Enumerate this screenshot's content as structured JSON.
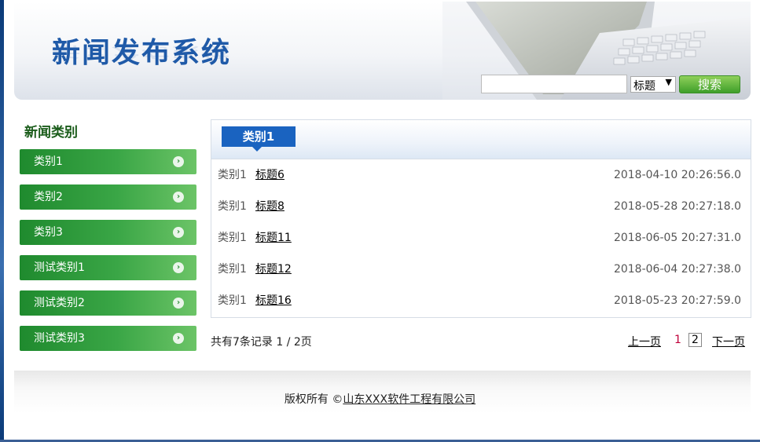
{
  "header": {
    "title": "新闻发布系统",
    "search": {
      "placeholder": "",
      "field_value": "",
      "select_value": "标题",
      "button_label": "搜索"
    }
  },
  "sidebar": {
    "title": "新闻类别",
    "items": [
      {
        "label": "类别1"
      },
      {
        "label": "类别2"
      },
      {
        "label": "类别3"
      },
      {
        "label": "测试类别1"
      },
      {
        "label": "测试类别2"
      },
      {
        "label": "测试类别3"
      }
    ]
  },
  "main": {
    "tab_label": "类别1",
    "news": [
      {
        "category": "类别1",
        "title": "标题6",
        "time": "2018-04-10 20:26:56.0"
      },
      {
        "category": "类别1",
        "title": "标题8",
        "time": "2018-05-28 20:27:18.0"
      },
      {
        "category": "类别1",
        "title": "标题11",
        "time": "2018-06-05 20:27:31.0"
      },
      {
        "category": "类别1",
        "title": "标题12",
        "time": "2018-06-04 20:27:38.0"
      },
      {
        "category": "类别1",
        "title": "标题16",
        "time": "2018-05-23 20:27:59.0"
      }
    ]
  },
  "pagination": {
    "summary": "共有7条记录 1 / 2页",
    "prev_label": "上一页",
    "current_page": "1",
    "next_page": "2",
    "next_label": "下一页"
  },
  "footer": {
    "prefix": "版权所有 ©",
    "company": "山东XXX软件工程有限公司"
  },
  "colors": {
    "title_blue": "#1f5aa8",
    "category_green": "#2d8f36",
    "tab_blue": "#1a63c0",
    "search_green": "#4caf35",
    "current_page_red": "#c0003a"
  }
}
